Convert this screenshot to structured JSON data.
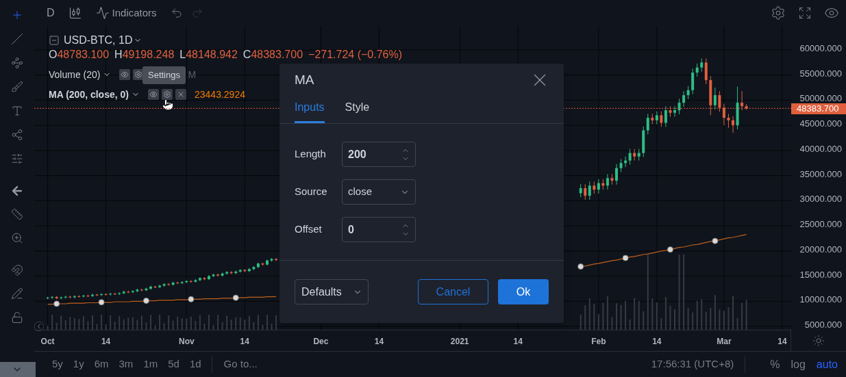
{
  "toolbar": {
    "interval": "D",
    "indicators_label": "Indicators",
    "undo_disabled": false,
    "redo_disabled": true
  },
  "legend": {
    "symbol": "USD-BTC, 1D",
    "ohlc": [
      {
        "key": "O",
        "value": "48783.100"
      },
      {
        "key": "H",
        "value": "49198.248"
      },
      {
        "key": "L",
        "value": "48148.942"
      },
      {
        "key": "C",
        "value": "48383.700"
      }
    ],
    "change": "−271.724 (−0.76%)",
    "studies": [
      {
        "name": "Volume (20)",
        "bold": false,
        "has_close": false,
        "value": "M",
        "color": "#5d606b"
      },
      {
        "name": "MA (200, close, 0)",
        "bold": true,
        "has_close": true,
        "value": "23443.2924",
        "color": "#f57c00"
      }
    ]
  },
  "tooltip": {
    "text": "Settings"
  },
  "chart_data": {
    "type": "candlestick",
    "x": [
      "2020-10-01",
      "2020-10-02",
      "2020-10-03",
      "2020-10-04",
      "2020-10-05",
      "2020-10-06",
      "2020-10-07",
      "2020-10-08",
      "2020-10-09",
      "2020-10-10",
      "2020-10-11",
      "2020-10-12",
      "2020-10-13",
      "2020-10-14",
      "2020-10-15",
      "2020-10-16",
      "2020-10-17",
      "2020-10-18",
      "2020-10-19",
      "2020-10-20",
      "2020-10-21",
      "2020-10-22",
      "2020-10-23",
      "2020-10-24",
      "2020-10-25",
      "2020-10-26",
      "2020-10-27",
      "2020-10-28",
      "2020-10-29",
      "2020-10-30",
      "2020-10-31",
      "2020-11-01",
      "2020-11-02",
      "2020-11-03",
      "2020-11-04",
      "2020-11-05",
      "2020-11-06",
      "2020-11-07",
      "2020-11-08",
      "2020-11-09",
      "2020-11-10",
      "2020-11-11",
      "2020-11-12",
      "2020-11-13",
      "2020-11-14",
      "2020-11-15",
      "2020-11-16",
      "2020-11-17",
      "2020-11-18",
      "2020-11-19",
      "2020-11-20",
      "2020-11-21",
      "2021-01-28",
      "2021-01-29",
      "2021-01-30",
      "2021-01-31",
      "2021-02-01",
      "2021-02-02",
      "2021-02-03",
      "2021-02-04",
      "2021-02-05",
      "2021-02-06",
      "2021-02-07",
      "2021-02-08",
      "2021-02-09",
      "2021-02-10",
      "2021-02-11",
      "2021-02-12",
      "2021-02-13",
      "2021-02-14",
      "2021-02-15",
      "2021-02-16",
      "2021-02-17",
      "2021-02-18",
      "2021-02-19",
      "2021-02-20",
      "2021-02-21",
      "2021-02-22",
      "2021-02-23",
      "2021-02-24",
      "2021-02-25",
      "2021-02-26",
      "2021-02-27",
      "2021-02-28",
      "2021-03-01",
      "2021-03-02",
      "2021-03-03",
      "2021-03-04",
      "2021-03-05",
      "2021-03-06"
    ],
    "ohlc": [
      [
        10600,
        10900,
        10400,
        10700
      ],
      [
        10700,
        11050,
        10500,
        10850
      ],
      [
        10850,
        11050,
        10400,
        10600
      ],
      [
        10600,
        10950,
        10400,
        10750
      ],
      [
        10750,
        11100,
        10550,
        10900
      ],
      [
        10900,
        11100,
        10600,
        10800
      ],
      [
        10800,
        11200,
        10600,
        11000
      ],
      [
        11000,
        11200,
        10750,
        10950
      ],
      [
        10950,
        11300,
        10750,
        11100
      ],
      [
        11100,
        11300,
        10850,
        11050
      ],
      [
        11050,
        11500,
        10850,
        11300
      ],
      [
        11300,
        11500,
        11050,
        11250
      ],
      [
        11250,
        11600,
        11050,
        11400
      ],
      [
        11400,
        11600,
        11150,
        11350
      ],
      [
        11350,
        11700,
        11150,
        11500
      ],
      [
        11500,
        11700,
        11250,
        11450
      ],
      [
        11450,
        11800,
        11250,
        11600
      ],
      [
        11600,
        12100,
        11400,
        11900
      ],
      [
        11900,
        12100,
        11600,
        11800
      ],
      [
        11800,
        12200,
        11600,
        12000
      ],
      [
        12000,
        12500,
        11800,
        12300
      ],
      [
        12300,
        12500,
        12000,
        12200
      ],
      [
        12200,
        12700,
        12000,
        12500
      ],
      [
        12500,
        13100,
        12300,
        12900
      ],
      [
        12900,
        13100,
        12600,
        12800
      ],
      [
        12800,
        13300,
        12600,
        13100
      ],
      [
        13100,
        13600,
        12900,
        13400
      ],
      [
        13400,
        13600,
        13100,
        13300
      ],
      [
        13300,
        13900,
        13100,
        13700
      ],
      [
        13700,
        13900,
        13400,
        13600
      ],
      [
        13600,
        14000,
        13400,
        13800
      ],
      [
        13800,
        14200,
        13600,
        14000
      ],
      [
        14000,
        14200,
        13700,
        13900
      ],
      [
        13900,
        14400,
        13700,
        14200
      ],
      [
        14200,
        14800,
        14000,
        14600
      ],
      [
        14600,
        14800,
        14200,
        14400
      ],
      [
        14400,
        15200,
        14200,
        15000
      ],
      [
        15000,
        15500,
        14800,
        15300
      ],
      [
        15300,
        15500,
        14900,
        15100
      ],
      [
        15100,
        15700,
        14900,
        15500
      ],
      [
        15500,
        16000,
        15300,
        15800
      ],
      [
        15800,
        16000,
        15400,
        15600
      ],
      [
        15600,
        16100,
        15400,
        15900
      ],
      [
        15900,
        16400,
        15700,
        16200
      ],
      [
        16200,
        16400,
        15800,
        16000
      ],
      [
        16000,
        16600,
        15800,
        16400
      ],
      [
        16400,
        17000,
        16200,
        16800
      ],
      [
        16800,
        17700,
        16600,
        17500
      ],
      [
        17500,
        17700,
        17100,
        17300
      ],
      [
        17300,
        18300,
        17100,
        18100
      ],
      [
        18100,
        18600,
        17900,
        18400
      ],
      [
        18400,
        18600,
        18000,
        18200
      ],
      [
        31500,
        33300,
        30700,
        32500
      ],
      [
        32500,
        33300,
        30200,
        31000
      ],
      [
        31000,
        33800,
        30200,
        33000
      ],
      [
        33000,
        33800,
        31400,
        32200
      ],
      [
        32200,
        34300,
        31400,
        33500
      ],
      [
        33500,
        34300,
        32200,
        33000
      ],
      [
        33000,
        35300,
        32200,
        34500
      ],
      [
        34500,
        35300,
        33200,
        34000
      ],
      [
        34000,
        37300,
        33200,
        36500
      ],
      [
        36500,
        38300,
        35700,
        37500
      ],
      [
        37500,
        38800,
        36700,
        38000
      ],
      [
        38000,
        40300,
        37200,
        39500
      ],
      [
        39500,
        40300,
        38000,
        38800
      ],
      [
        38800,
        40300,
        38000,
        39500
      ],
      [
        39500,
        44800,
        38700,
        44000
      ],
      [
        44000,
        47300,
        43200,
        46500
      ],
      [
        46500,
        47300,
        45200,
        46000
      ],
      [
        46000,
        47800,
        45200,
        47000
      ],
      [
        47000,
        47800,
        44700,
        45500
      ],
      [
        45500,
        48800,
        44700,
        48000
      ],
      [
        48000,
        48800,
        46700,
        47500
      ],
      [
        47500,
        48800,
        46700,
        48000
      ],
      [
        48000,
        50300,
        47200,
        49500
      ],
      [
        49500,
        51800,
        48700,
        51000
      ],
      [
        51000,
        52800,
        50200,
        52000
      ],
      [
        52000,
        56300,
        51200,
        55500
      ],
      [
        55500,
        57300,
        54700,
        56500
      ],
      [
        56500,
        58300,
        55700,
        57500
      ],
      [
        57500,
        58300,
        53200,
        54000
      ],
      [
        54000,
        54800,
        47000,
        49000
      ],
      [
        49000,
        52500,
        48200,
        51000
      ],
      [
        51000,
        51800,
        47700,
        48500
      ],
      [
        48500,
        49300,
        45000,
        46500
      ],
      [
        46500,
        47300,
        44500,
        46000
      ],
      [
        46000,
        46800,
        43500,
        45000
      ],
      [
        45000,
        52700,
        44200,
        49500
      ],
      [
        49500,
        51800,
        48000,
        48800
      ],
      [
        48800,
        49200,
        48100,
        48383
      ]
    ],
    "xlim": [
      "2020-09-28",
      "2021-03-16"
    ],
    "ylim": [
      4186,
      64764
    ],
    "grid": true,
    "series": [
      {
        "type": "line",
        "color": "#c0601c",
        "values": [
          9400,
          9400,
          9500,
          9500,
          9500,
          9600,
          9600,
          9600,
          9600,
          9700,
          9700,
          9700,
          9800,
          9800,
          9800,
          9900,
          9900,
          9900,
          9900,
          10000,
          10000,
          10000,
          10100,
          10100,
          10100,
          10200,
          10200,
          10200,
          10200,
          10300,
          10300,
          10300,
          10400,
          10400,
          10400,
          10500,
          10500,
          10500,
          10500,
          10600,
          10600,
          10600,
          10700,
          10700,
          10700,
          10800,
          10800,
          10800,
          10800,
          10900,
          10900,
          10900,
          16900,
          17000,
          17200,
          17400,
          17500,
          17700,
          17900,
          18100,
          18200,
          18400,
          18600,
          18800,
          18900,
          19100,
          19300,
          19400,
          19600,
          19800,
          20000,
          20100,
          20300,
          20500,
          20700,
          20800,
          21000,
          21200,
          21300,
          21500,
          21700,
          21900,
          22000,
          22200,
          22400,
          22600,
          22700,
          22900,
          23100,
          23300
        ]
      }
    ],
    "xticks": [
      {
        "value": "2020-10-01",
        "label": "Oct"
      },
      {
        "value": "2020-10-14",
        "label": "14"
      },
      {
        "value": "2020-11-01",
        "label": "Nov"
      },
      {
        "value": "2020-11-14",
        "label": "14"
      },
      {
        "value": "2020-12-01",
        "label": "Dec"
      },
      {
        "value": "2020-12-14",
        "label": "14"
      },
      {
        "value": "2021-01-01",
        "label": "2021"
      },
      {
        "value": "2021-01-14",
        "label": "14"
      },
      {
        "value": "2021-02-01",
        "label": "Feb"
      },
      {
        "value": "2021-02-14",
        "label": "14"
      },
      {
        "value": "2021-03-01",
        "label": "Mar"
      },
      {
        "value": "2021-03-14",
        "label": "14"
      }
    ],
    "yticks": [
      {
        "value": 60000,
        "label": "60000.000"
      },
      {
        "value": 55000,
        "label": "55000.000"
      },
      {
        "value": 50000,
        "label": "50000.000"
      },
      {
        "value": 45000,
        "label": "45000.000"
      },
      {
        "value": 40000,
        "label": "40000.000"
      },
      {
        "value": 35000,
        "label": "35000.000"
      },
      {
        "value": 30000,
        "label": "30000.000"
      },
      {
        "value": 25000,
        "label": "25000.000"
      },
      {
        "value": 20000,
        "label": "20000.000"
      },
      {
        "value": 15000,
        "label": "15000.000"
      },
      {
        "value": 10000,
        "label": "10000.000"
      },
      {
        "value": 5000,
        "label": "5000.000"
      }
    ]
  },
  "last_price": "48383.700",
  "dialog": {
    "title": "MA",
    "tabs": [
      {
        "label": "Inputs",
        "selected": true
      },
      {
        "label": "Style",
        "selected": false
      }
    ],
    "fields": [
      {
        "kind": "number",
        "label": "Length",
        "value": "200"
      },
      {
        "kind": "select",
        "label": "Source",
        "value": "close"
      },
      {
        "kind": "number",
        "label": "Offset",
        "value": "0"
      }
    ],
    "defaults_label": "Defaults",
    "buttons": [
      {
        "kind": "secondary",
        "label": "Cancel"
      },
      {
        "kind": "primary",
        "label": "Ok"
      }
    ]
  },
  "bottom_bar": {
    "ranges": [
      "5y",
      "1y",
      "6m",
      "3m",
      "1m",
      "5d",
      "1d"
    ],
    "goto": "Go to...",
    "time": "17:56:31 (UTC+8)",
    "scale_options": [
      {
        "label": "%",
        "selected": false
      },
      {
        "label": "log",
        "selected": false
      },
      {
        "label": "auto",
        "selected": true
      }
    ]
  }
}
